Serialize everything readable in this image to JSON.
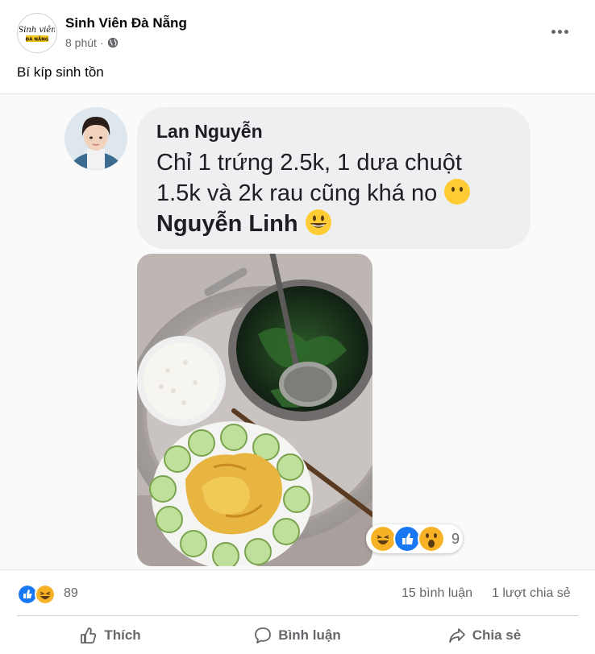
{
  "header": {
    "page_name": "Sinh Viên Đà Nẵng",
    "time": "8 phút",
    "separator": "·",
    "avatar_logo_text": "Sinh viên",
    "avatar_logo_sub": "ĐÀ NẴNG",
    "audience_icon": "globe-icon",
    "more_icon": "more-options-icon"
  },
  "caption": "Bí kíp sinh tồn",
  "media": {
    "comment_author": "Lan Nguyễn",
    "comment_line1": "Chỉ 1 trứng 2.5k, 1 dưa chuột",
    "comment_line2": "1.5k và 2k rau cũng khá no",
    "comment_mention": "Nguyễn Linh",
    "comment_reaction_count": "9",
    "comment_reactions": [
      "haha",
      "like",
      "wow"
    ]
  },
  "summary": {
    "reactions": [
      "like",
      "haha"
    ],
    "like_count": "89",
    "comment_count": "15 bình luận",
    "share_count": "1 lượt chia sẻ"
  },
  "actions": {
    "like_label": "Thích",
    "comment_label": "Bình luận",
    "share_label": "Chia sẻ"
  },
  "colors": {
    "like_blue": "#1877f2",
    "haha_yellow": "#f7b125",
    "secondary_text": "#65676b"
  }
}
